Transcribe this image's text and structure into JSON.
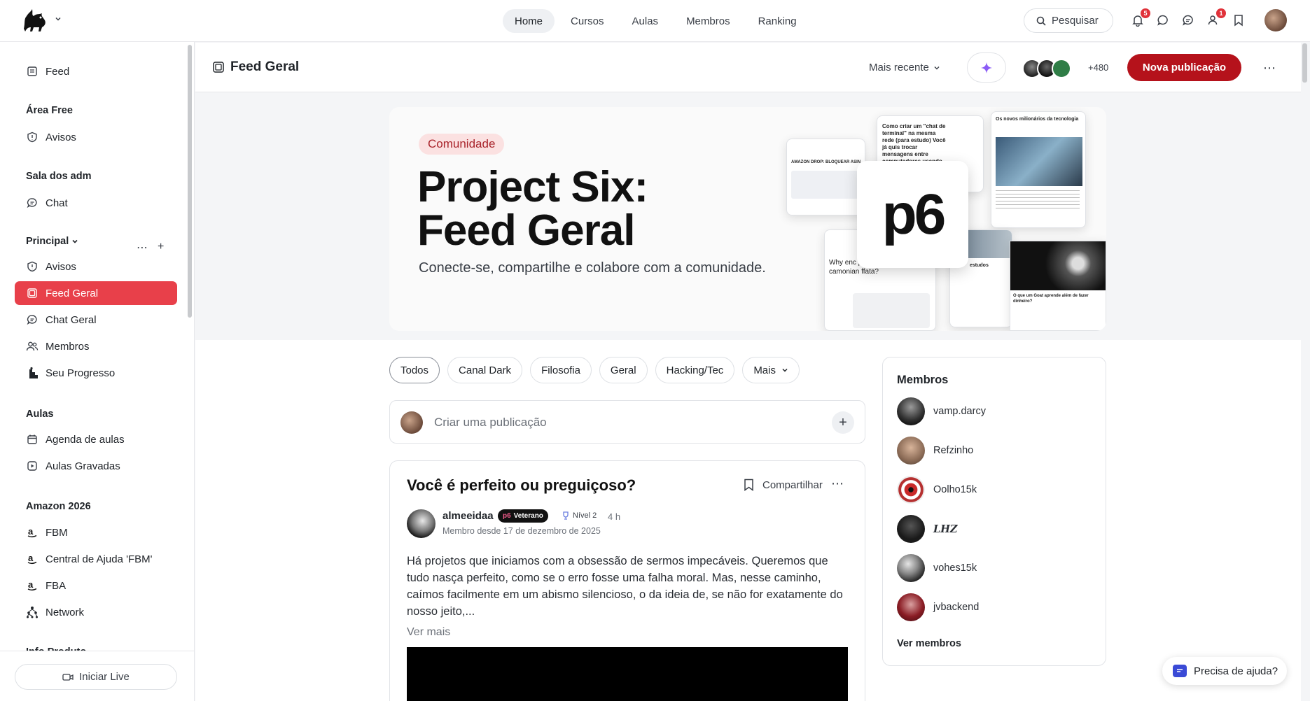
{
  "nav": {
    "items": [
      "Home",
      "Cursos",
      "Aulas",
      "Membros",
      "Ranking"
    ],
    "active": "Home"
  },
  "search": {
    "label": "Pesquisar"
  },
  "notifications": {
    "count": "5"
  },
  "invites": {
    "count": "1"
  },
  "sidebar": {
    "feed": "Feed",
    "sections": [
      {
        "title": "Área Free",
        "items": [
          "Avisos"
        ]
      },
      {
        "title": "Sala dos adm",
        "items": [
          "Chat"
        ]
      },
      {
        "title": "Principal",
        "items": [
          "Avisos",
          "Feed Geral",
          "Chat Geral",
          "Membros",
          "Seu Progresso"
        ]
      },
      {
        "title": "Aulas",
        "items": [
          "Agenda de aulas",
          "Aulas Gravadas"
        ]
      },
      {
        "title": "Amazon 2026",
        "items": [
          "FBM",
          "Central de Ajuda 'FBM'",
          "FBA",
          "Network"
        ]
      },
      {
        "title": "Info Produto",
        "items": []
      }
    ],
    "active_item": "Feed Geral",
    "live_button": "Iniciar Live"
  },
  "header": {
    "title": "Feed Geral",
    "sort": "Mais recente",
    "member_count": "+480",
    "new_post": "Nova publicação"
  },
  "hero": {
    "tag": "Comunidade",
    "title_line1": "Project Six:",
    "title_line2": "Feed Geral",
    "subtitle": "Conecte-se, compartilhe e colabore com a comunidade.",
    "logo_text": "p6",
    "mock_card1": "Como criar um \"chat de terminal\" na mesma rede (para estudo) Você já quis trocar mensagens entre computadores usando só terminal? Isso é o",
    "mock_card2": "Os novos milionários da tecnologia",
    "mock_card3": "AMAZON DROP: BLOQUEAR ASIN",
    "mock_card4": "Why enc principais camonian ffata?",
    "mock_card5": "O que um Goat aprende além de fazer dinheiro?",
    "mock_card6": "estudos"
  },
  "filters": [
    "Todos",
    "Canal Dark",
    "Filosofia",
    "Geral",
    "Hacking/Tec"
  ],
  "filters_more": "Mais",
  "composer": {
    "placeholder": "Criar uma publicação"
  },
  "post": {
    "title": "Você é perfeito ou preguiçoso?",
    "share": "Compartilhar",
    "author": "almeeidaa",
    "badge": "Veterano",
    "badge_logo": "p6",
    "level": "Nível 2",
    "time": "4 h",
    "member_since": "Membro desde 17 de dezembro de 2025",
    "body": "Há projetos que iniciamos com a obsessão de sermos impecáveis. Queremos que tudo nasça perfeito, como se o erro fosse uma falha moral. Mas, nesse caminho, caímos facilmente em um abismo silencioso, o da ideia de, se não for exatamente do nosso jeito,...",
    "see_more": "Ver mais"
  },
  "members": {
    "title": "Membros",
    "list": [
      "vamp.darcy",
      "Refzinho",
      "Oolho15k",
      "𝑳𝑯𝒁",
      "vohes15k",
      "jvbackend"
    ],
    "see_all": "Ver membros"
  },
  "help": {
    "label": "Precisa de ajuda?"
  },
  "colors": {
    "accent": "#e8404a",
    "primary_button": "#b5121b",
    "badge": "#e0323a"
  }
}
